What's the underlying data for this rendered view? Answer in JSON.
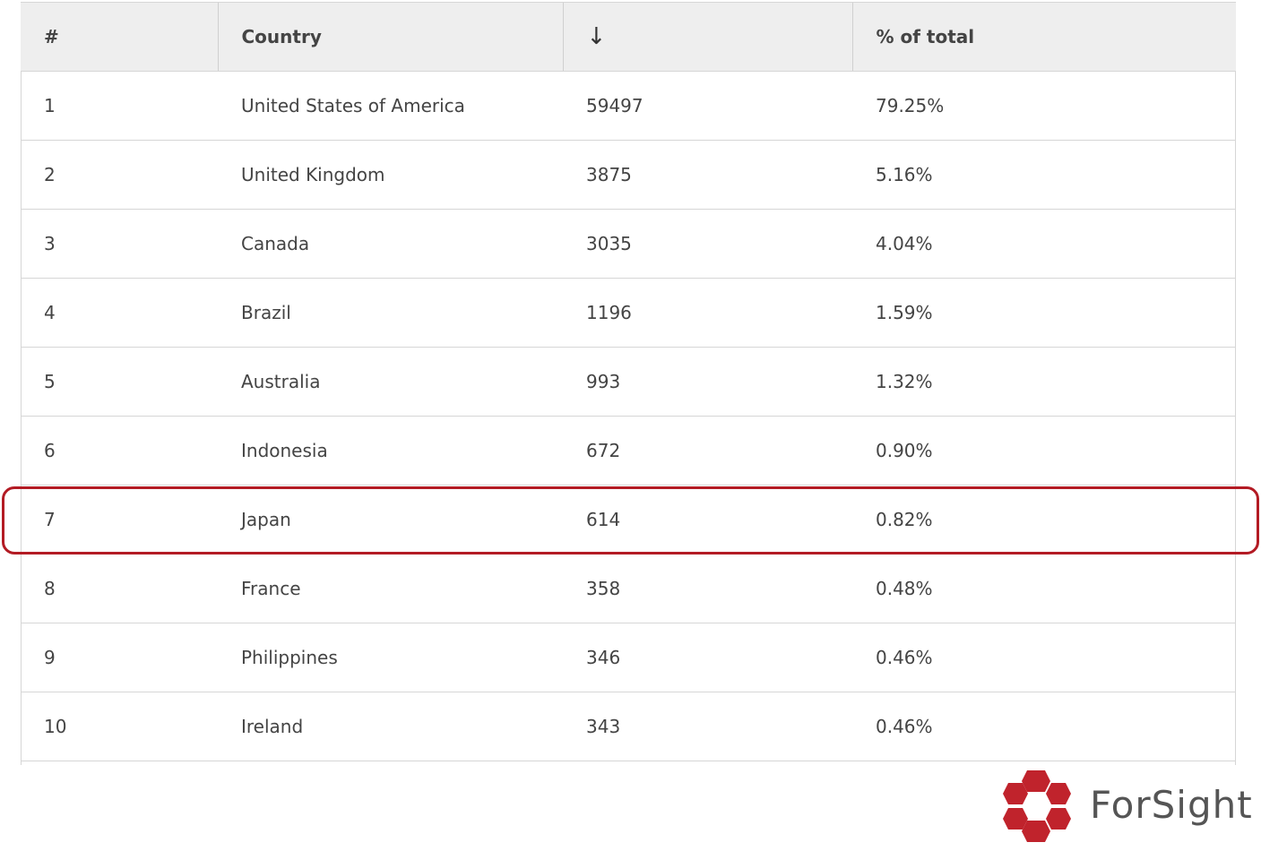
{
  "table": {
    "headers": {
      "rank": "#",
      "country": "Country",
      "value_sort_icon": "↓",
      "percent": "% of total"
    },
    "rows": [
      {
        "rank": "1",
        "country": "United States of America",
        "value": "59497",
        "percent": "79.25%"
      },
      {
        "rank": "2",
        "country": "United Kingdom",
        "value": "3875",
        "percent": "5.16%"
      },
      {
        "rank": "3",
        "country": "Canada",
        "value": "3035",
        "percent": "4.04%"
      },
      {
        "rank": "4",
        "country": "Brazil",
        "value": "1196",
        "percent": "1.59%"
      },
      {
        "rank": "5",
        "country": "Australia",
        "value": "993",
        "percent": "1.32%"
      },
      {
        "rank": "6",
        "country": "Indonesia",
        "value": "672",
        "percent": "0.90%"
      },
      {
        "rank": "7",
        "country": "Japan",
        "value": "614",
        "percent": "0.82%"
      },
      {
        "rank": "8",
        "country": "France",
        "value": "358",
        "percent": "0.48%"
      },
      {
        "rank": "9",
        "country": "Philippines",
        "value": "346",
        "percent": "0.46%"
      },
      {
        "rank": "10",
        "country": "Ireland",
        "value": "343",
        "percent": "0.46%"
      }
    ]
  },
  "highlight": {
    "row_rank": "7",
    "color": "#b31b24"
  },
  "logo": {
    "text": "ForSight",
    "icon": "hexagon-cluster-icon",
    "color": "#c0232c"
  }
}
